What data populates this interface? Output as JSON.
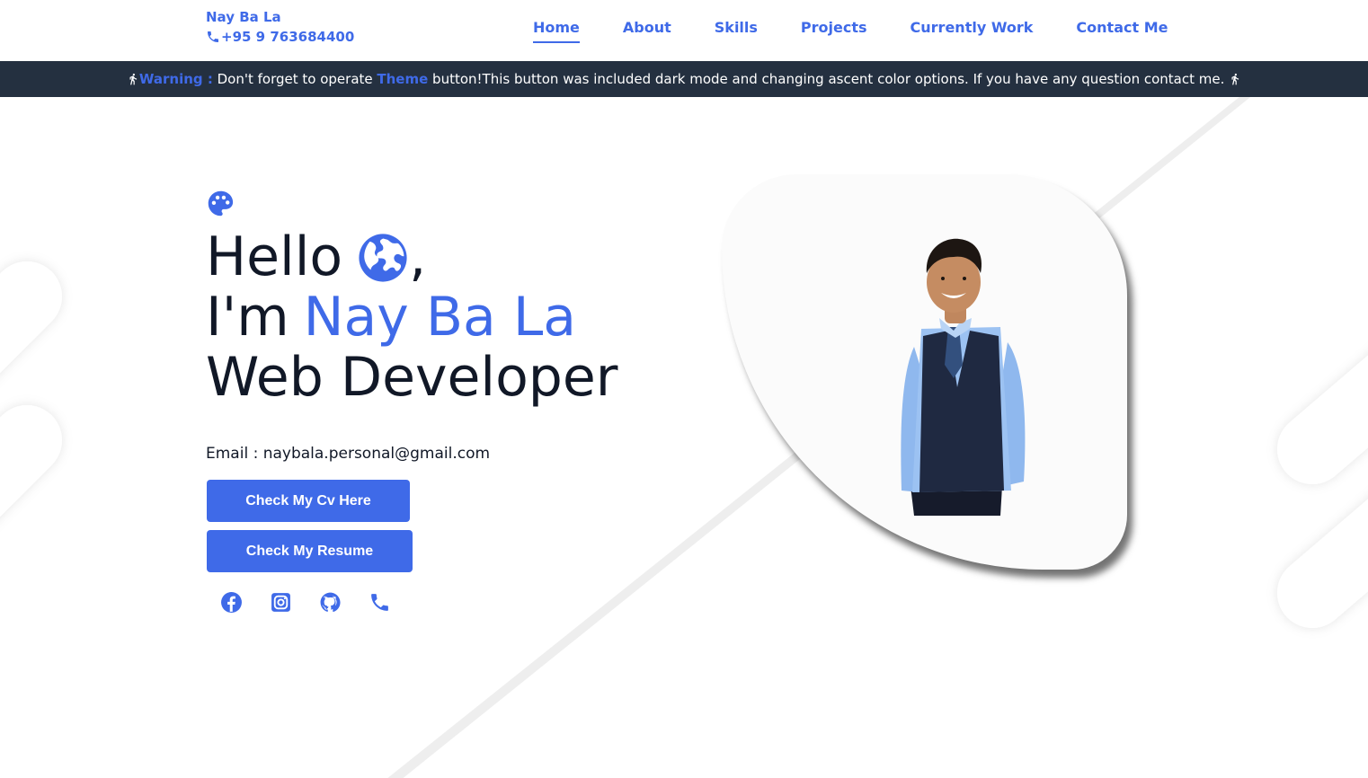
{
  "header": {
    "name": "Nay Ba La",
    "phone": "+95 9 763684400",
    "nav": [
      {
        "label": "Home",
        "active": true
      },
      {
        "label": "About"
      },
      {
        "label": "Skills"
      },
      {
        "label": "Projects"
      },
      {
        "label": "Currently Work"
      },
      {
        "label": "Contact Me"
      }
    ]
  },
  "warning": {
    "label": "Warning :",
    "text_before": " Don't forget to operate ",
    "theme": "Theme",
    "text_after": " button!This button was included dark mode and changing ascent color options. If you have any question contact me. "
  },
  "hero": {
    "hello": "Hello",
    "comma": ",",
    "im": "I'm",
    "name": "Nay Ba La",
    "role": "Web Developer",
    "email": "Email : naybala.personal@gmail.com",
    "cv_button": "Check My Cv Here",
    "resume_button": "Check My Resume",
    "socials": [
      "facebook-icon",
      "instagram-icon",
      "github-icon",
      "phone-icon"
    ]
  },
  "colors": {
    "accent": "#3f6ae8",
    "warning_bg": "#243040",
    "text": "#111827"
  }
}
